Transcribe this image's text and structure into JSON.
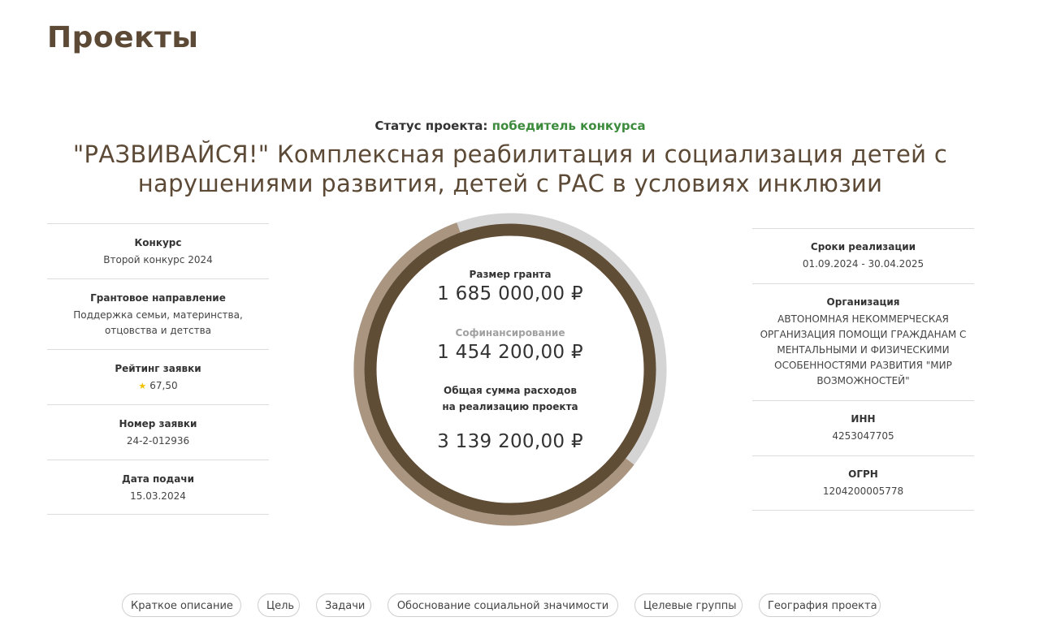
{
  "page": {
    "title": "Проекты"
  },
  "status": {
    "label": "Статус проекта:",
    "value": "победитель конкурса",
    "value_color": "#3d8b3d"
  },
  "project": {
    "title": "\"РАЗВИВАЙСЯ!\" Комплексная реабилитация и социализация детей с нарушениями развития, детей с РАС в условиях инклюзии"
  },
  "left_info": [
    {
      "label": "Конкурс",
      "value": "Второй конкурс 2024"
    },
    {
      "label": "Грантовое направление",
      "value": "Поддержка семьи, материнства, отцовства и детства"
    },
    {
      "label": "Рейтинг заявки",
      "value": "67,50",
      "icon": "star-icon"
    },
    {
      "label": "Номер заявки",
      "value": "24-2-012936"
    },
    {
      "label": "Дата подачи",
      "value": "15.03.2024"
    }
  ],
  "right_info": [
    {
      "label": "Сроки реализации",
      "value": "01.09.2024 - 30.04.2025"
    },
    {
      "label": "Организация",
      "value": "АВТОНОМНАЯ НЕКОММЕРЧЕСКАЯ ОРГАНИЗАЦИЯ ПОМОЩИ ГРАЖДАНАМ С МЕНТАЛЬНЫМИ И ФИЗИЧЕСКИМИ ОСОБЕННОСТЯМИ РАЗВИТИЯ \"МИР ВОЗМОЖНОСТЕЙ\""
    },
    {
      "label": "ИНН",
      "value": "4253047705"
    },
    {
      "label": "ОГРН",
      "value": "1204200005778"
    }
  ],
  "finance": {
    "grant_label": "Размер гранта",
    "grant_amount": "1 685 000,00 ₽",
    "cofinancing_label": "Софинансирование",
    "cofinancing_amount": "1 454 200,00 ₽",
    "total_label": "Общая сумма расходов на реализацию проекта",
    "total_amount": "3 139 200,00 ₽",
    "grant_value": 1685000,
    "cofinancing_value": 1454200,
    "total_value": 3139200,
    "colors": {
      "inner_ring": "#604d36",
      "outer_ring": "#a99580",
      "track": "#d4d4d4",
      "cofinancing_label": "#a0a0a0"
    }
  },
  "tabs": [
    "Краткое описание",
    "Цель",
    "Задачи",
    "Обоснование социальной значимости",
    "Целевые группы",
    "География проекта"
  ]
}
